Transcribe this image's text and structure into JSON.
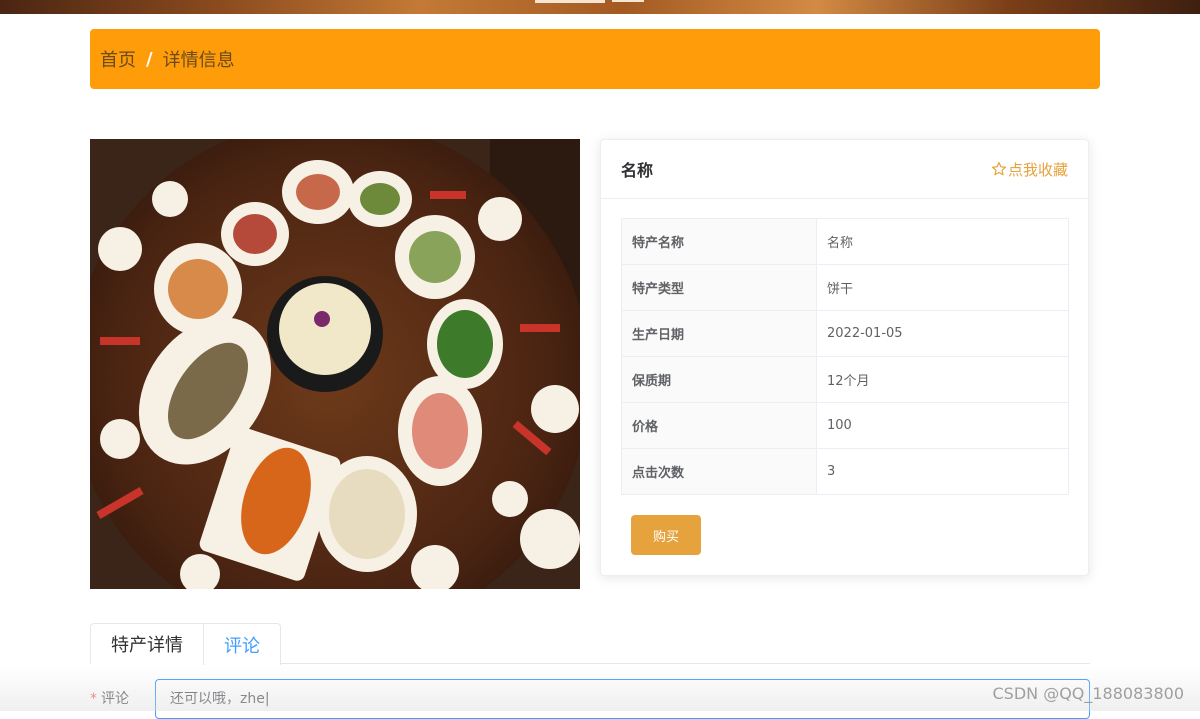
{
  "breadcrumb": {
    "home": "首页",
    "separator": "/",
    "current": "详情信息"
  },
  "card": {
    "title": "名称",
    "favorite_label": "点我收藏",
    "favorite_icon": "star-outline-icon",
    "rows": [
      {
        "label": "特产名称",
        "value": "名称"
      },
      {
        "label": "特产类型",
        "value": "饼干"
      },
      {
        "label": "生产日期",
        "value": "2022-01-05"
      },
      {
        "label": "保质期",
        "value": "12个月"
      },
      {
        "label": "价格",
        "value": "100"
      },
      {
        "label": "点击次数",
        "value": "3"
      }
    ],
    "buy_label": "购买"
  },
  "tabs": [
    {
      "label": "特产详情",
      "active": false
    },
    {
      "label": "评论",
      "active": true
    }
  ],
  "comment": {
    "label": "评论",
    "required_mark": "*",
    "value": "还可以哦，zhe|"
  },
  "watermark": "CSDN @QQ_188083800",
  "colors": {
    "accent": "#ff9c09",
    "button": "#e6a23c",
    "tab_active": "#409eff"
  }
}
